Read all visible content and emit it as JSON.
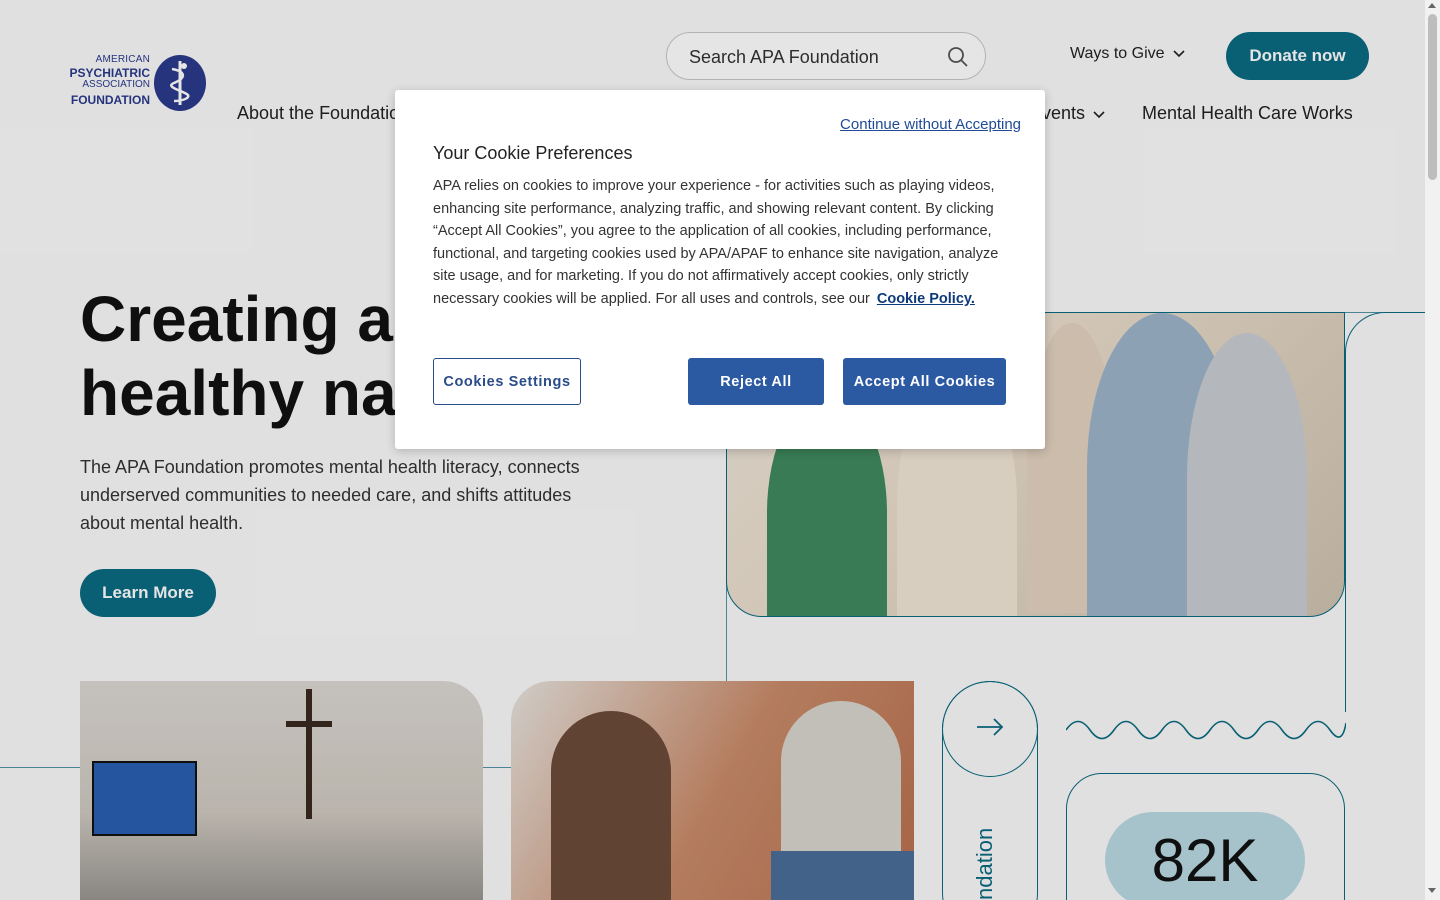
{
  "logo": {
    "line1": "AMERICAN",
    "line2": "PSYCHIATRIC",
    "line3": "ASSOCIATION",
    "line4": "FOUNDATION"
  },
  "search": {
    "placeholder": "Search APA Foundation"
  },
  "header": {
    "ways_to_give": "Ways to Give",
    "donate": "Donate now"
  },
  "nav": {
    "about": "About the Foundation",
    "events": "Events",
    "mhcw": "Mental Health Care Works"
  },
  "hero": {
    "title_line1": "Creating a m",
    "title_line2": "healthy nati",
    "description": "The APA Foundation promotes mental health literacy, connects underserved communities to needed care, and shifts attitudes about mental health.",
    "cta": "Learn More"
  },
  "feature": {
    "vertical_text": "ndation",
    "stat": "82K"
  },
  "cookie_modal": {
    "continue_link": "Continue without Accepting",
    "title": "Your Cookie Preferences",
    "body": "APA relies on cookies to improve your experience - for activities such as playing videos, enhancing site performance, analyzing traffic, and showing relevant content. By clicking “Accept All Cookies”, you agree to the application of all cookies, including performance, functional, and targeting cookies used by APA/APAF to enhance site navigation, analyze site usage, and for marketing. If you do not affirmatively accept cookies, only strictly necessary cookies will be applied. For all uses and controls, see our",
    "policy_link": "Cookie Policy.",
    "settings_button": "Cookies Settings",
    "reject_button": "Reject All",
    "accept_button": "Accept All Cookies"
  },
  "colors": {
    "brand_teal": "#0b6a82",
    "brand_navy": "#2a3a8c",
    "cookie_blue": "#2b5aa3"
  }
}
